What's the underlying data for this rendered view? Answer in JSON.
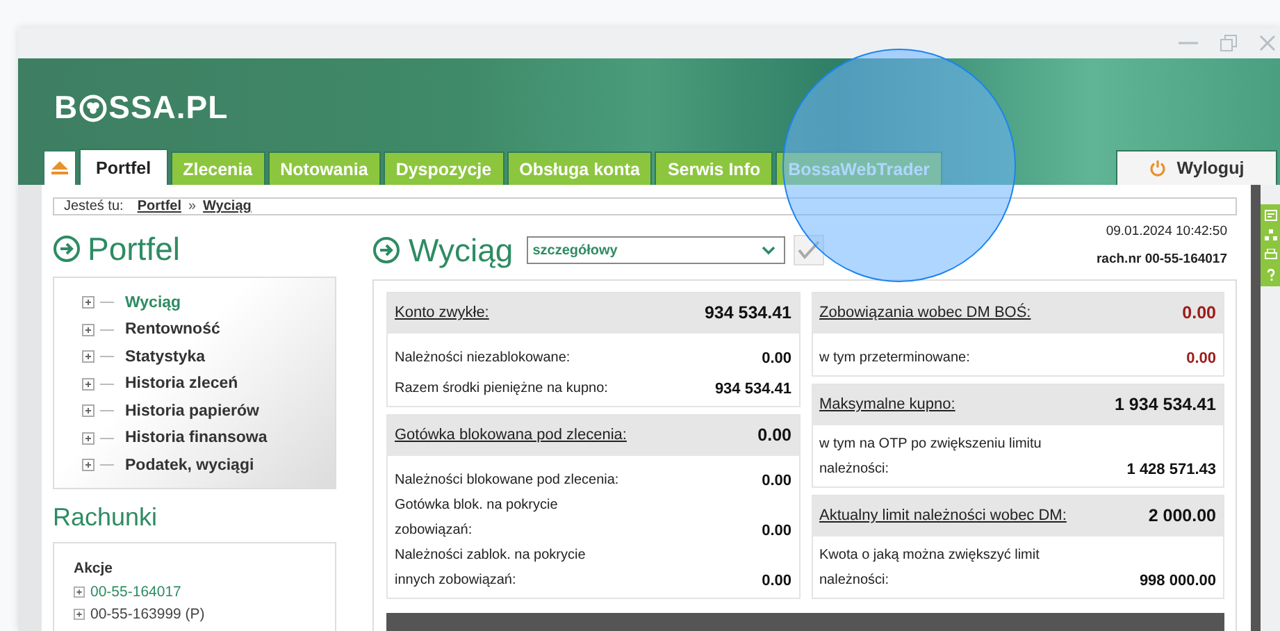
{
  "logo": {
    "before": "B",
    "after": "SSA.PL"
  },
  "tabs": [
    {
      "label": "Portfel",
      "selected": true
    },
    {
      "label": "Zlecenia",
      "selected": false
    },
    {
      "label": "Notowania",
      "selected": false
    },
    {
      "label": "Dyspozycje",
      "selected": false
    },
    {
      "label": "Obsługa konta",
      "selected": false
    },
    {
      "label": "Serwis Info",
      "selected": false
    },
    {
      "label": "BossaWebTrader",
      "selected": false
    }
  ],
  "logout": "Wyloguj",
  "breadcrumb": {
    "label": "Jesteś tu:",
    "links": [
      "Portfel",
      "Wyciąg"
    ],
    "separator": "»"
  },
  "sidebar": {
    "title": "Portfel",
    "items": [
      {
        "label": "Wyciąg",
        "selected": true
      },
      {
        "label": "Rentowność",
        "selected": false
      },
      {
        "label": "Statystyka",
        "selected": false
      },
      {
        "label": "Historia zleceń",
        "selected": false
      },
      {
        "label": "Historia papierów",
        "selected": false
      },
      {
        "label": "Historia finansowa",
        "selected": false
      },
      {
        "label": "Podatek, wyciągi",
        "selected": false
      }
    ]
  },
  "accounts": {
    "title": "Rachunki",
    "group": "Akcje",
    "items": [
      {
        "label": "00-55-164017",
        "selected": true
      },
      {
        "label": "00-55-163999 (P)",
        "selected": false
      }
    ]
  },
  "statement": {
    "title": "Wyciąg",
    "view": "szczegółowy",
    "date": "09.01.2024 10:42:50",
    "account": "rach.nr 00-55-164017",
    "columns": [
      [
        {
          "heading": "Konto zwykłe:",
          "value": "934 534.41",
          "alert": false,
          "rows": [
            {
              "label": "Należności niezablokowane:",
              "value": "0.00",
              "alert": false
            },
            {
              "label": "Razem środki pieniężne na kupno:",
              "value": "934 534.41",
              "alert": false
            }
          ]
        },
        {
          "heading": "Gotówka blokowana pod zlecenia:",
          "value": "0.00",
          "alert": false,
          "rows": [
            {
              "label": "Należności blokowane pod zlecenia:",
              "value": "0.00",
              "alert": false
            },
            {
              "label": "Gotówka blok. na pokrycie zobowiązań:",
              "value": "0.00",
              "alert": false
            },
            {
              "label": "Należności zablok. na pokrycie innych zobowiązań:",
              "value": "0.00",
              "alert": false
            }
          ]
        }
      ],
      [
        {
          "heading": "Zobowiązania wobec DM BOŚ:",
          "value": "0.00",
          "alert": true,
          "rows": [
            {
              "label": "w tym przeterminowane:",
              "value": "0.00",
              "alert": true
            }
          ]
        },
        {
          "heading": "Maksymalne kupno:",
          "value": "1 934 534.41",
          "alert": false,
          "rows": [
            {
              "label": "w tym na OTP po zwiększeniu limitu należności:",
              "value": "1 428 571.43",
              "alert": false
            }
          ]
        },
        {
          "heading": "Aktualny limit należności wobec DM:",
          "value": "2 000.00",
          "alert": false,
          "rows": [
            {
              "label": "Kwota o jaką można zwiększyć limit należności:",
              "value": "998 000.00",
              "alert": false
            }
          ]
        }
      ]
    ]
  }
}
